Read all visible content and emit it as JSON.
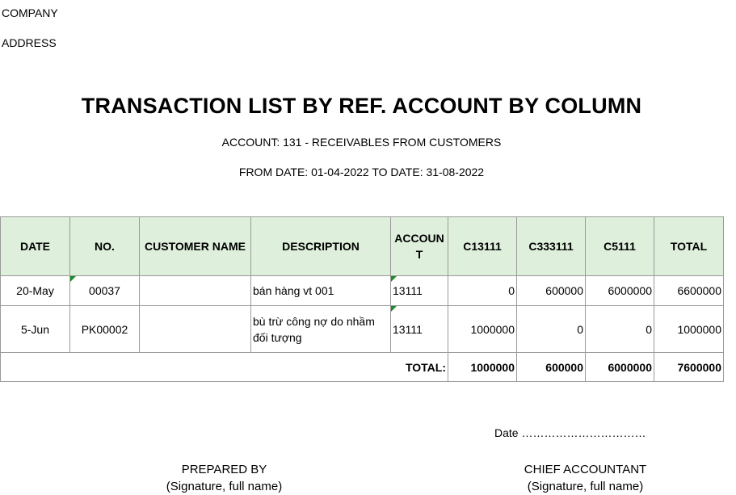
{
  "header": {
    "company": "COMPANY",
    "address": "ADDRESS"
  },
  "report": {
    "title": "TRANSACTION LIST BY REF. ACCOUNT BY COLUMN",
    "account_line": "ACCOUNT: 131 - RECEIVABLES FROM CUSTOMERS",
    "date_range": "FROM DATE: 01-04-2022 TO DATE: 31-08-2022"
  },
  "table": {
    "columns": [
      "DATE",
      "NO.",
      "CUSTOMER NAME",
      "DESCRIPTION",
      "ACCOUNT",
      "C13111",
      "C333111",
      "C5111",
      "TOTAL"
    ],
    "rows": [
      {
        "date": "20-May",
        "no": "00037",
        "customer": "",
        "description": "bán hàng vt 001",
        "account": "13111",
        "c13111": "0",
        "c333111": "600000",
        "c5111": "6000000",
        "total": "6600000"
      },
      {
        "date": "5-Jun",
        "no": "PK00002",
        "customer": "",
        "description": "bù trừ công nợ do nhầm đối tượng",
        "account": "13111",
        "c13111": "1000000",
        "c333111": "0",
        "c5111": "0",
        "total": "1000000"
      }
    ],
    "totals": {
      "label": "TOTAL:",
      "c13111": "1000000",
      "c333111": "600000",
      "c5111": "6000000",
      "total": "7600000"
    }
  },
  "footer": {
    "date_line": "Date ……………………………",
    "prepared_by": "PREPARED BY",
    "prepared_sig": "(Signature, full name)",
    "chief_accountant": "CHIEF ACCOUNTANT",
    "chief_sig": "(Signature, full name)"
  }
}
